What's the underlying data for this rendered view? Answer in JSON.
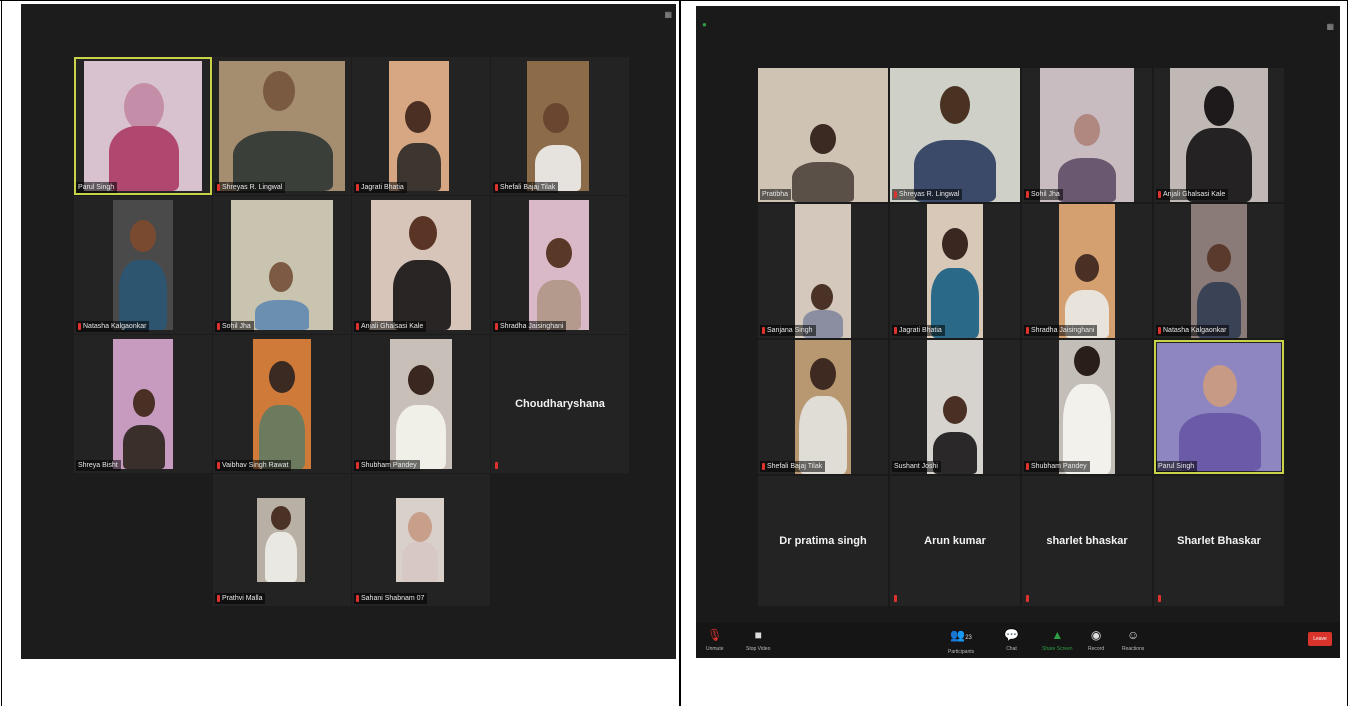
{
  "screenshot_left": {
    "tiles": [
      {
        "name": "Parul Singh",
        "active": true
      },
      {
        "name": "Shreyas R. Lingwal"
      },
      {
        "name": "Jagrati Bhatia"
      },
      {
        "name": "Shefali Bajaj Tilak"
      },
      {
        "name": "Natasha Kalgaonkar"
      },
      {
        "name": "Sohil Jha"
      },
      {
        "name": "Anjali Ghalsasi Kale"
      },
      {
        "name": "Shradha Jaisinghani"
      },
      {
        "name": "Shreya Bisht"
      },
      {
        "name": "Vaibhav Singh Rawat"
      },
      {
        "name": "Shubham Pandey"
      },
      {
        "name": "Choudharyshana",
        "no_video": true
      },
      {
        "name": "Prathvi Malla"
      },
      {
        "name": "Sahani Shabnam 07"
      }
    ],
    "top_right_icon": "view-icon"
  },
  "screenshot_right": {
    "tiles": [
      {
        "name": "Pratibha"
      },
      {
        "name": "Shreyas R. Lingwal"
      },
      {
        "name": "Sohil Jha"
      },
      {
        "name": "Anjali Ghalsasi Kale"
      },
      {
        "name": "Sanjana Singh"
      },
      {
        "name": "Jagrati Bhatia"
      },
      {
        "name": "Shradha Jaisinghani"
      },
      {
        "name": "Natasha Kalgaonkar"
      },
      {
        "name": "Shefali Bajaj Tilak"
      },
      {
        "name": "Sushant Joshi"
      },
      {
        "name": "Shubham Pandey"
      },
      {
        "name": "Parul Singh",
        "active": true
      },
      {
        "name": "Dr pratima singh",
        "no_video": true
      },
      {
        "name": "Arun kumar",
        "no_video": true
      },
      {
        "name": "sharlet bhaskar",
        "no_video": true
      },
      {
        "name": "Sharlet Bhaskar",
        "no_video": true
      }
    ],
    "toolbar": {
      "mute": "Unmute",
      "video": "Stop Video",
      "participants": "Participants",
      "participants_count": "23",
      "chat": "Chat",
      "share": "Share Screen",
      "record": "Record",
      "reactions": "Reactions",
      "end": "Leave"
    },
    "accent_green": "#2ea043",
    "end_red": "#d9342b"
  }
}
